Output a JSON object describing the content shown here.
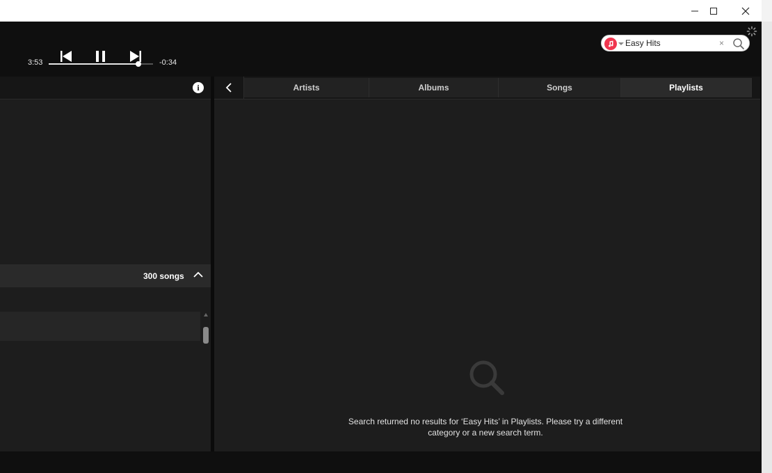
{
  "window": {
    "controls": {
      "minimize": "minimize",
      "maximize": "maximize",
      "close": "close"
    }
  },
  "player": {
    "elapsed": "3:53",
    "remaining": "-0:34",
    "progress": 0.86,
    "icons": [
      "previous-icon",
      "pause-icon",
      "next-icon",
      "miniplayer-icon",
      "equalizer-icon"
    ]
  },
  "search": {
    "value": "Easy Hits",
    "placeholder": "Search",
    "clear_label": "×",
    "source_icon": "music-note-icon",
    "accent": "#f0364f"
  },
  "left_panel": {
    "info_label": "i",
    "song_count": "300 songs"
  },
  "right_panel": {
    "tabs": [
      {
        "label": "Artists"
      },
      {
        "label": "Albums"
      },
      {
        "label": "Songs"
      },
      {
        "label": "Playlists",
        "active": true
      }
    ],
    "empty_message": "Search returned no results for ‘Easy Hits’ in Playlists. Please try a different category or a new search term."
  },
  "colors": {
    "background": "#0f0f0f",
    "panel": "#1d1d1d",
    "text": "#e2e2e2"
  }
}
